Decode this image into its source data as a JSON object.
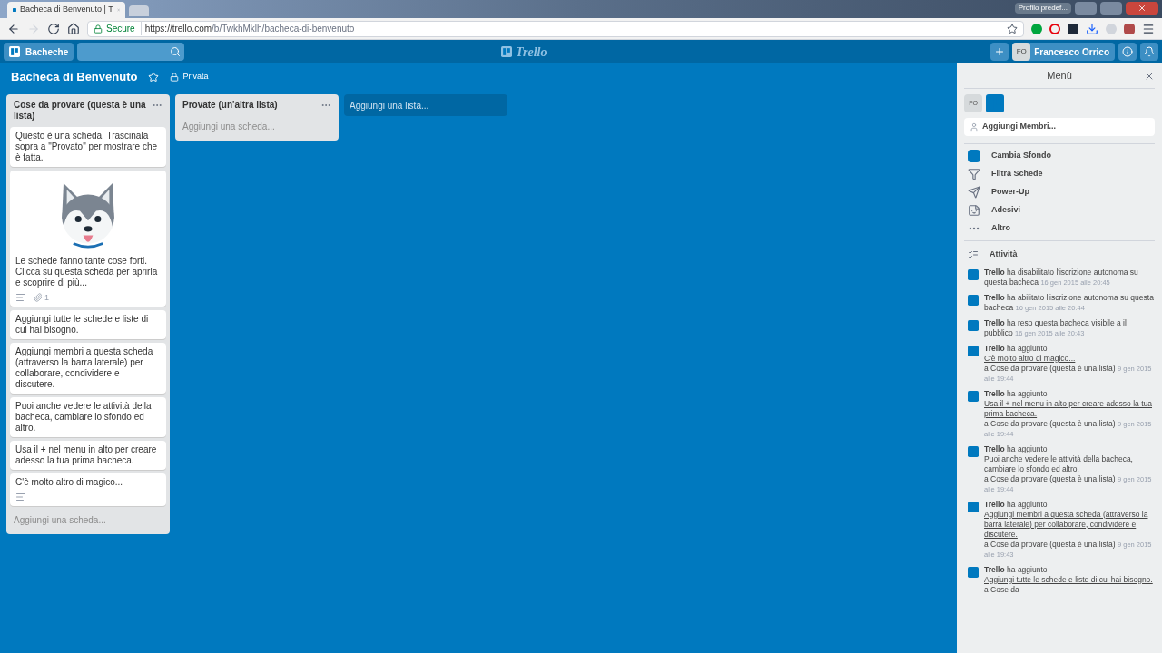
{
  "browser": {
    "tab_title": "Bacheca di Benvenuto | T",
    "profile": "Profilo predef...",
    "secure_label": "Secure",
    "url_host": "https://trello.com",
    "url_path": "/b/TwkhMklh/bacheca-di-benvenuto"
  },
  "header": {
    "boards_button": "Bacheche",
    "logo": "Trello",
    "avatar": "FO",
    "user": "Francesco Orrico"
  },
  "board": {
    "title": "Bacheca di Benvenuto",
    "starred": false,
    "visibility": "Privata"
  },
  "lists": [
    {
      "title": "Cose da provare (questa è una lista)",
      "add_card": "Aggiungi una scheda...",
      "cards": [
        {
          "kind": "text",
          "text": "Questo è una scheda. Trascinala sopra a \"Provato\" per mostrare che è fatta."
        },
        {
          "kind": "image",
          "text": "Le schede fanno tante cose forti. Clicca su questa scheda per aprirla e scoprire di più...",
          "description": true,
          "attachments": "1"
        },
        {
          "kind": "text",
          "text": "Aggiungi tutte le schede e liste di cui hai bisogno."
        },
        {
          "kind": "text",
          "text": "Aggiungi membri a questa scheda (attraverso la barra laterale) per collaborare, condividere e discutere."
        },
        {
          "kind": "text",
          "text": "Puoi anche vedere le attività della bacheca, cambiare lo sfondo ed altro."
        },
        {
          "kind": "text",
          "text": "Usa il + nel menu in alto per creare adesso la tua prima bacheca."
        },
        {
          "kind": "text",
          "text": "C'è molto altro di magico...",
          "description": true
        }
      ]
    },
    {
      "title": "Provate (un'altra lista)",
      "add_card": "Aggiungi una scheda..."
    }
  ],
  "add_list": "Aggiungi una lista...",
  "menu": {
    "title": "Menù",
    "avatar": "FO",
    "add_members": "Aggiungi Membri...",
    "items": [
      {
        "kind": "background",
        "label": "Cambia Sfondo",
        "color": "#0079bf"
      },
      {
        "kind": "filter",
        "label": "Filtra Schede"
      },
      {
        "kind": "powerup",
        "label": "Power-Up"
      },
      {
        "kind": "stickers",
        "label": "Adesivi"
      },
      {
        "kind": "more",
        "label": "Altro"
      }
    ],
    "activity_title": "Attività",
    "activity": [
      {
        "actor": "Trello",
        "action": "ha disabilitato l'iscrizione autonoma su questa bacheca",
        "time": "16 gen 2015 alle 20:45"
      },
      {
        "actor": "Trello",
        "action": "ha abilitato l'iscrizione autonoma su questa bacheca",
        "time": "16 gen 2015 alle 20:44"
      },
      {
        "actor": "Trello",
        "action": "ha reso questa bacheca visibile a il pubblico",
        "time": "16 gen 2015 alle 20:43"
      },
      {
        "actor": "Trello",
        "action": "ha aggiunto",
        "link": "C'è molto altro di magico...",
        "rest": "a Cose da provare (questa è una lista)",
        "time": "9 gen 2015 alle 19:44"
      },
      {
        "actor": "Trello",
        "action": "ha aggiunto",
        "link": "Usa il + nel menu in alto per creare adesso la tua prima bacheca.",
        "rest": "a Cose da provare (questa è una lista)",
        "time": "9 gen 2015 alle 19:44"
      },
      {
        "actor": "Trello",
        "action": "ha aggiunto",
        "link": "Puoi anche vedere le attività della bacheca, cambiare lo sfondo ed altro.",
        "rest": "a Cose da provare (questa è una lista)",
        "time": "9 gen 2015 alle 19:44"
      },
      {
        "actor": "Trello",
        "action": "ha aggiunto",
        "link": "Aggiungi membri a questa scheda (attraverso la barra laterale) per collaborare, condividere e discutere.",
        "rest": "a Cose da provare (questa è una lista)",
        "time": "9 gen 2015 alle 19:43"
      },
      {
        "actor": "Trello",
        "action": "ha aggiunto",
        "link": "Aggiungi tutte le schede e liste di cui hai bisogno.",
        "rest": "a Cose da"
      }
    ]
  }
}
